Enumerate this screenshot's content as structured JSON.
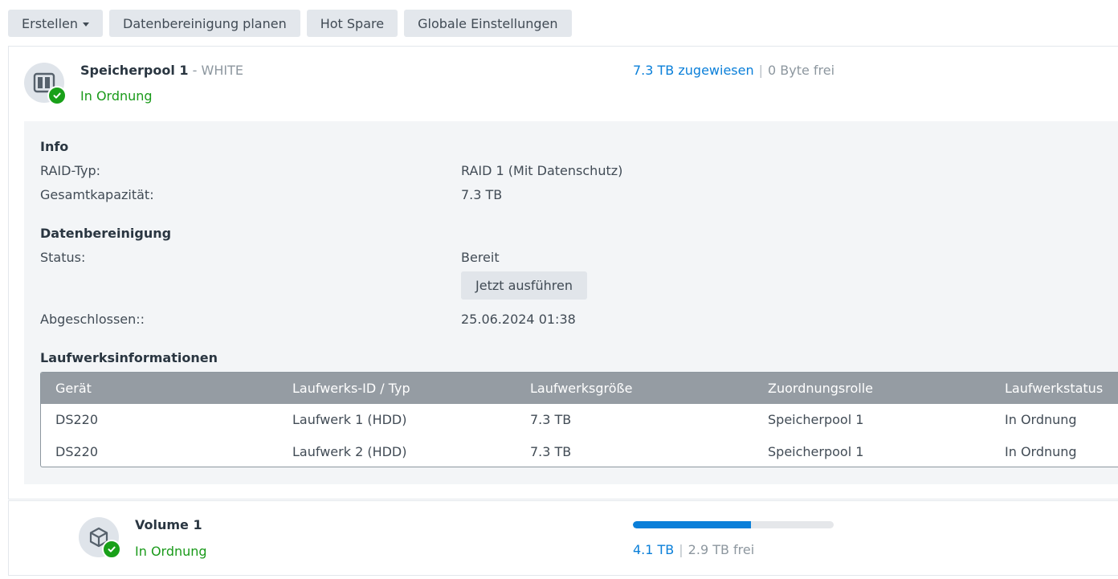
{
  "toolbar": {
    "create_label": "Erstellen",
    "schedule_scrub_label": "Datenbereinigung planen",
    "hot_spare_label": "Hot Spare",
    "global_settings_label": "Globale Einstellungen"
  },
  "pool": {
    "name": "Speicherpool 1",
    "separator": " - ",
    "host": "WHITE",
    "status": "In Ordnung",
    "allocated": "7.3 TB zugewiesen",
    "divider": "|",
    "free": "0 Byte frei",
    "info": {
      "title": "Info",
      "raid_type_label": "RAID-Typ:",
      "raid_type_value": "RAID 1 (Mit Datenschutz)",
      "capacity_label": "Gesamtkapazität:",
      "capacity_value": "7.3 TB"
    },
    "scrubbing": {
      "title": "Datenbereinigung",
      "status_label": "Status:",
      "status_value": "Bereit",
      "run_now_label": "Jetzt ausführen",
      "completed_label": "Abgeschlossen::",
      "completed_value": "25.06.2024 01:38"
    },
    "drives": {
      "title": "Laufwerksinformationen",
      "columns": [
        "Gerät",
        "Laufwerks-ID / Typ",
        "Laufwerksgröße",
        "Zuordnungsrolle",
        "Laufwerkstatus"
      ],
      "rows": [
        [
          "DS220",
          "Laufwerk 1 (HDD)",
          "7.3 TB",
          "Speicherpool 1",
          "In Ordnung"
        ],
        [
          "DS220",
          "Laufwerk 2 (HDD)",
          "7.3 TB",
          "Speicherpool 1",
          "In Ordnung"
        ]
      ]
    }
  },
  "volume": {
    "name": "Volume 1",
    "status": "In Ordnung",
    "used": "4.1 TB",
    "divider": "|",
    "free": "2.9 TB frei",
    "usage_fraction": 0.586
  },
  "colors": {
    "ok": "#1a9a1a",
    "accent": "#0a7fd9",
    "table_header": "#959ca3"
  },
  "icons": {
    "pool": "storage-pool-icon",
    "volume": "volume-cube-icon",
    "status": "check-circle-icon",
    "dropdown": "caret-down-icon"
  }
}
